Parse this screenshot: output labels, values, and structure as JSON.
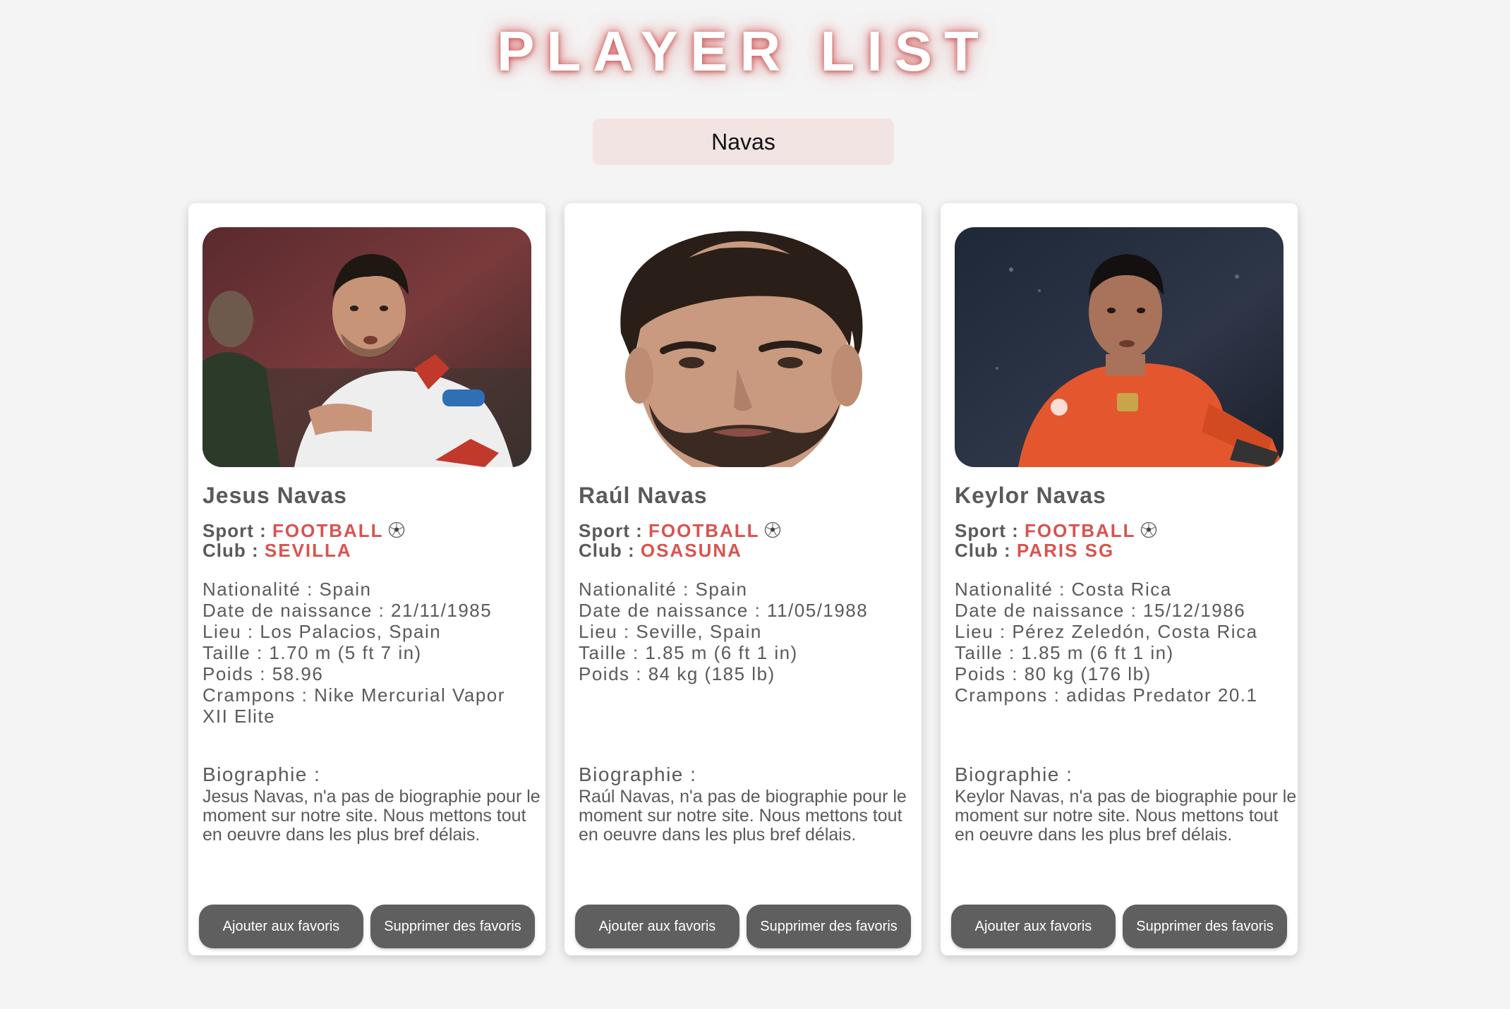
{
  "page": {
    "title": "PLAYER LIST"
  },
  "search": {
    "value": "Navas"
  },
  "colors": {
    "accent": "#d9534f",
    "text": "#5a5a5a",
    "button_bg": "#5f5f5f",
    "search_bg": "#f3e4e4"
  },
  "cards": [
    {
      "name": "Jesus Navas",
      "sport_label": "Sport :",
      "sport": "FOOTBALL",
      "sport_icon": "soccer-ball-icon",
      "club_label": "Club :",
      "club": "SEVILLA",
      "nationality": "Nationalité : Spain",
      "birth_date": "Date de naissance : 21/11/1985",
      "birth_place": "Lieu : Los Palacios, Spain",
      "height": "Taille : 1.70 m (5 ft 7 in)",
      "weight": "Poids : 58.96",
      "boots": "Crampons : Nike Mercurial Vapor XII Elite",
      "bio_title": "Biographie :",
      "bio": "Jesus Navas, n'a pas de biographie pour le moment sur notre site. Nous mettons tout en oeuvre dans les plus bref délais.",
      "add_label": "Ajouter aux favoris",
      "remove_label": "Supprimer des favoris"
    },
    {
      "name": "Raúl Navas",
      "sport_label": "Sport :",
      "sport": "FOOTBALL",
      "sport_icon": "soccer-ball-icon",
      "club_label": "Club :",
      "club": "OSASUNA",
      "nationality": "Nationalité : Spain",
      "birth_date": "Date de naissance : 11/05/1988",
      "birth_place": "Lieu : Seville, Spain",
      "height": "Taille : 1.85 m (6 ft 1 in)",
      "weight": "Poids : 84 kg (185 lb)",
      "boots": "",
      "bio_title": "Biographie :",
      "bio": "Raúl Navas, n'a pas de biographie pour le moment sur notre site. Nous mettons tout en oeuvre dans les plus bref délais.",
      "add_label": "Ajouter aux favoris",
      "remove_label": "Supprimer des favoris"
    },
    {
      "name": "Keylor Navas",
      "sport_label": "Sport :",
      "sport": "FOOTBALL",
      "sport_icon": "soccer-ball-icon",
      "club_label": "Club :",
      "club": "PARIS SG",
      "nationality": "Nationalité : Costa Rica",
      "birth_date": "Date de naissance : 15/12/1986",
      "birth_place": "Lieu : Pérez Zeledón, Costa Rica",
      "height": "Taille : 1.85 m (6 ft 1 in)",
      "weight": "Poids : 80 kg (176 lb)",
      "boots": "Crampons : adidas Predator 20.1",
      "bio_title": "Biographie :",
      "bio": "Keylor Navas, n'a pas de biographie pour le moment sur notre site. Nous mettons tout en oeuvre dans les plus bref délais.",
      "add_label": "Ajouter aux favoris",
      "remove_label": "Supprimer des favoris"
    }
  ]
}
